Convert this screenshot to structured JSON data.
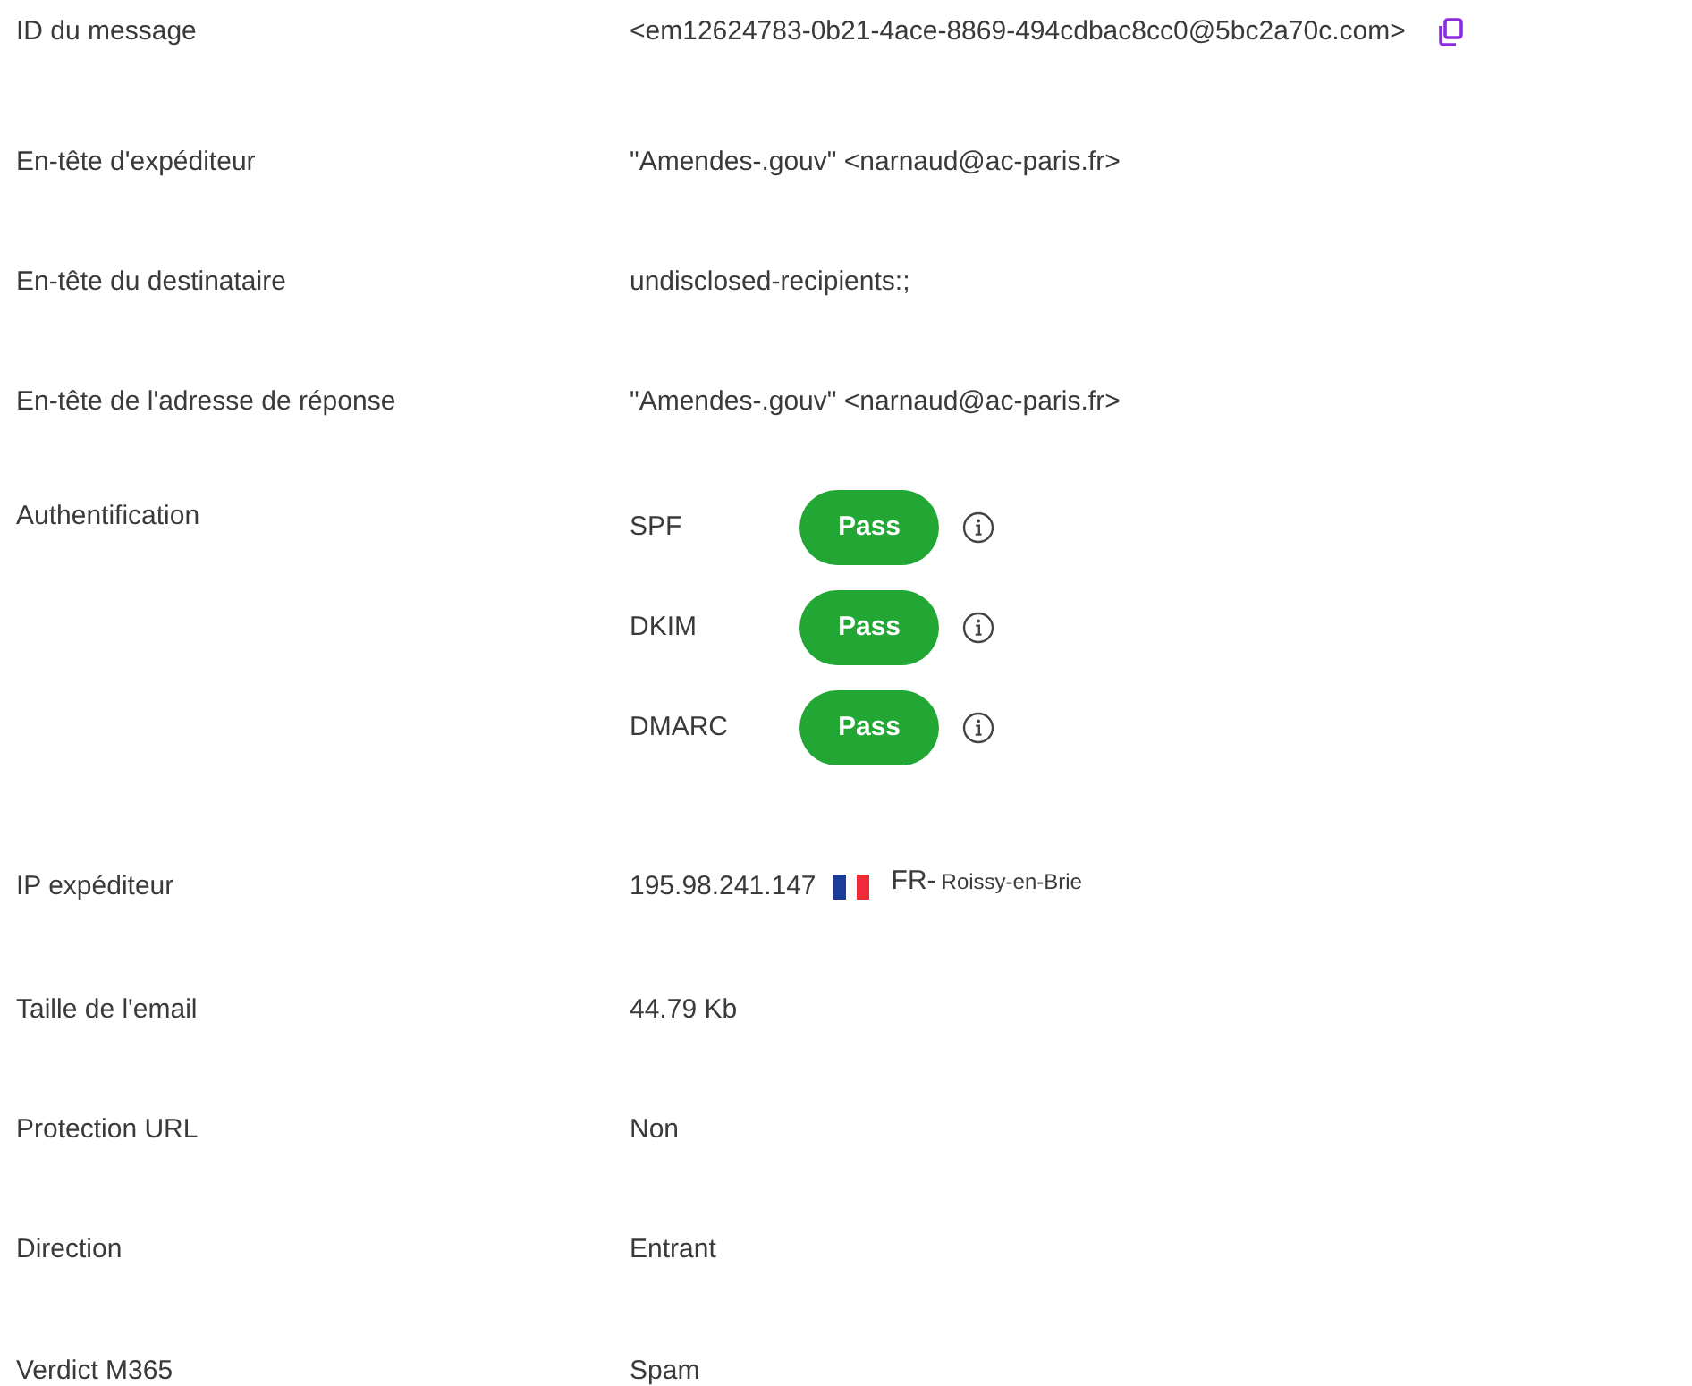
{
  "rows": [
    {
      "kind": "copy",
      "label": "ID du message",
      "value": "<em12624783-0b21-4ace-8869-494cdbac8cc0@5bc2a70c.com>"
    },
    {
      "kind": "text",
      "label": "En-tête d'expéditeur",
      "value": "\"Amendes-.gouv\" <narnaud@ac-paris.fr>"
    },
    {
      "kind": "text",
      "label": "En-tête du destinataire",
      "value": "undisclosed-recipients:;"
    },
    {
      "kind": "text",
      "label": "En-tête de l'adresse de réponse",
      "value": "\"Amendes-.gouv\" <narnaud@ac-paris.fr>"
    },
    {
      "kind": "auth",
      "label": "Authentification",
      "checks": [
        {
          "name": "SPF",
          "result": "Pass"
        },
        {
          "name": "DKIM",
          "result": "Pass"
        },
        {
          "name": "DMARC",
          "result": "Pass"
        }
      ]
    },
    {
      "kind": "ip",
      "label": "IP expéditeur",
      "value": "195.98.241.147",
      "country": "FR-",
      "city": "Roissy-en-Brie"
    },
    {
      "kind": "text",
      "label": "Taille de l'email",
      "value": "44.79 Kb"
    },
    {
      "kind": "text",
      "label": "Protection URL",
      "value": "Non"
    },
    {
      "kind": "text",
      "label": "Direction",
      "value": "Entrant"
    },
    {
      "kind": "text",
      "label": "Verdict M365",
      "value": "Spam"
    }
  ]
}
